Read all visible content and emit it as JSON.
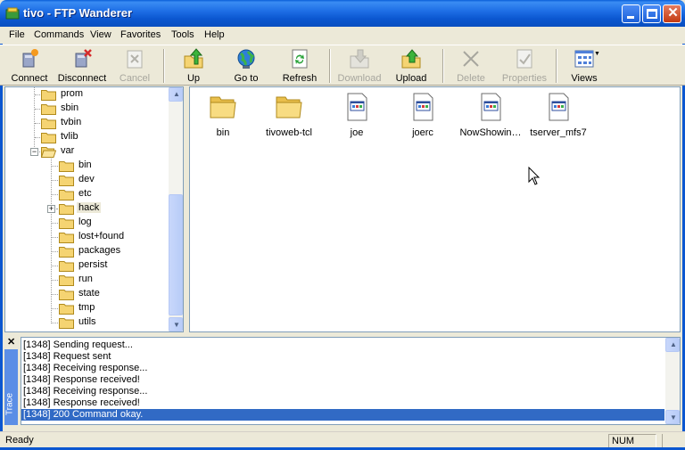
{
  "window": {
    "title": "tivo - FTP Wanderer"
  },
  "menu": [
    "File",
    "Commands",
    "View",
    "Favorites",
    "Tools",
    "Help"
  ],
  "toolbar": {
    "connect": "Connect",
    "disconnect": "Disconnect",
    "cancel": "Cancel",
    "up": "Up",
    "goto": "Go to",
    "refresh": "Refresh",
    "download": "Download",
    "upload": "Upload",
    "delete": "Delete",
    "properties": "Properties",
    "views": "Views"
  },
  "tree": {
    "items": [
      {
        "label": "prom"
      },
      {
        "label": "sbin"
      },
      {
        "label": "tvbin"
      },
      {
        "label": "tvlib"
      },
      {
        "label": "var"
      },
      {
        "label": "bin"
      },
      {
        "label": "dev"
      },
      {
        "label": "etc"
      },
      {
        "label": "hack"
      },
      {
        "label": "log"
      },
      {
        "label": "lost+found"
      },
      {
        "label": "packages"
      },
      {
        "label": "persist"
      },
      {
        "label": "run"
      },
      {
        "label": "state"
      },
      {
        "label": "tmp"
      },
      {
        "label": "utils"
      }
    ],
    "selected": "hack"
  },
  "files": [
    {
      "name": "bin",
      "type": "folder"
    },
    {
      "name": "tivoweb-tcl",
      "type": "folder"
    },
    {
      "name": "joe",
      "type": "exe"
    },
    {
      "name": "joerc",
      "type": "exe"
    },
    {
      "name": "NowShowin…",
      "type": "exe"
    },
    {
      "name": "tserver_mfs7",
      "type": "exe"
    }
  ],
  "log": {
    "tab_label": "Trace",
    "lines": [
      "[1348] Sending request...",
      "[1348] Request sent",
      "[1348] Receiving response...",
      "[1348] Response received!",
      "[1348] Receiving response...",
      "[1348] Response received!",
      "[1348] 200 Command okay."
    ]
  },
  "status": {
    "text": "Ready",
    "num": "NUM"
  },
  "colors": {
    "titlebar": "#0b57d0",
    "selection": "#316ac5",
    "folder": "#f5d472"
  }
}
